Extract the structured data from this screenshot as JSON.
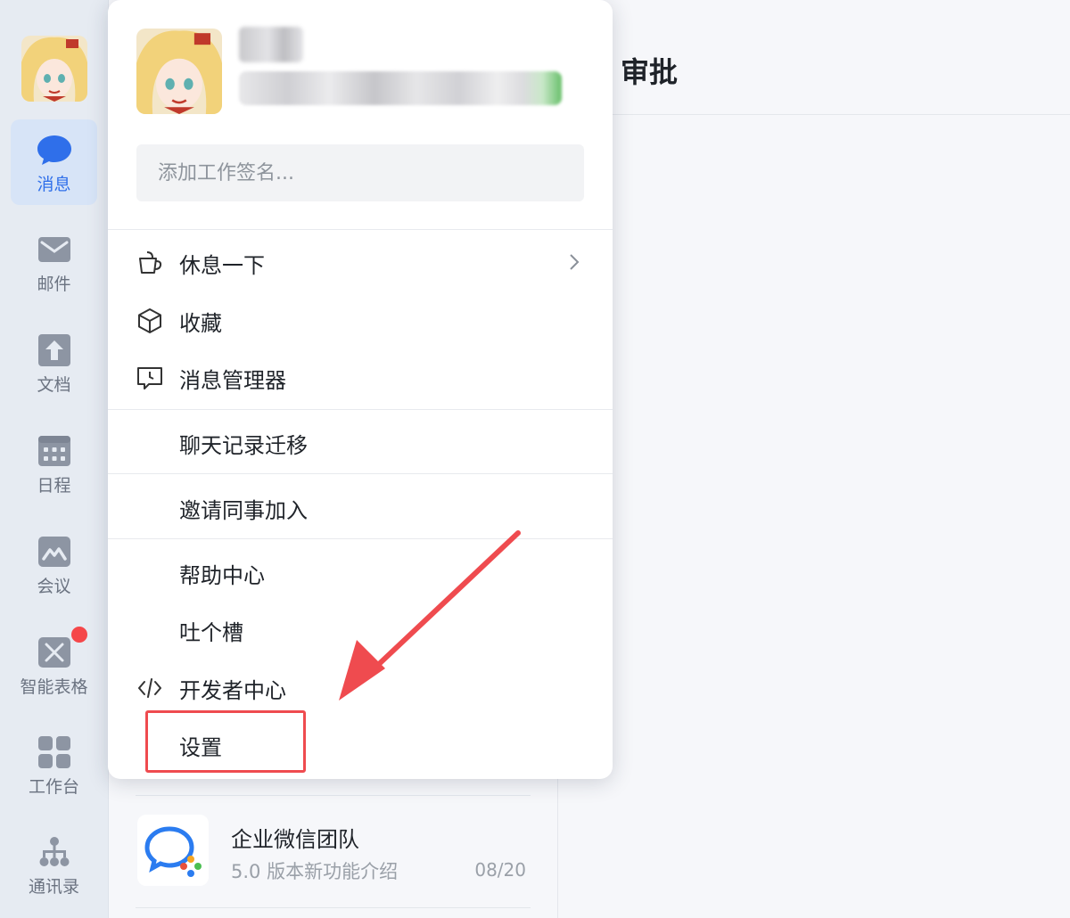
{
  "sidebar": {
    "items": [
      {
        "label": "消息",
        "icon": "chat-icon",
        "active": true
      },
      {
        "label": "邮件",
        "icon": "mail-icon"
      },
      {
        "label": "文档",
        "icon": "document-icon"
      },
      {
        "label": "日程",
        "icon": "calendar-icon"
      },
      {
        "label": "会议",
        "icon": "meeting-icon"
      },
      {
        "label": "智能表格",
        "icon": "smart-sheet-icon",
        "badge": true
      },
      {
        "label": "工作台",
        "icon": "workbench-icon"
      },
      {
        "label": "通讯录",
        "icon": "contacts-icon"
      }
    ]
  },
  "popup": {
    "signature_placeholder": "添加工作签名...",
    "menu": [
      {
        "label": "休息一下",
        "icon": "coffee-cup-icon",
        "has_submenu": true
      },
      {
        "label": "收藏",
        "icon": "cube-icon"
      },
      {
        "label": "消息管理器",
        "icon": "message-manager-icon"
      },
      {
        "label": "聊天记录迁移"
      },
      {
        "label": "邀请同事加入"
      },
      {
        "label": "帮助中心"
      },
      {
        "label": "吐个槽"
      },
      {
        "label": "开发者中心",
        "icon": "code-icon"
      },
      {
        "label": "设置",
        "highlighted": true
      }
    ]
  },
  "chat_list": {
    "items": [
      {
        "title": "企业微信团队",
        "subtitle": "5.0 版本新功能介绍",
        "time": "08/20"
      }
    ]
  },
  "main": {
    "title": "审批"
  },
  "colors": {
    "accent": "#2f6fea",
    "highlight": "#ef4b4f",
    "badge": "#f5474a"
  }
}
